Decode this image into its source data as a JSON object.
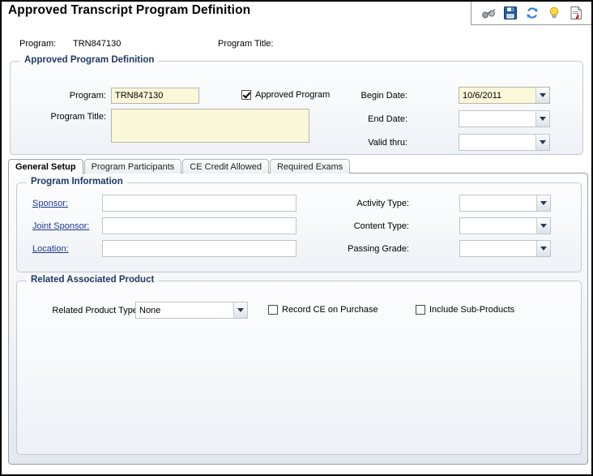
{
  "window": {
    "title": "Approved Transcript Program Definition"
  },
  "toolbar": {
    "items": [
      {
        "name": "binoculars-icon",
        "tooltip": "Find"
      },
      {
        "name": "save-icon",
        "tooltip": "Save"
      },
      {
        "name": "refresh-icon",
        "tooltip": "Refresh"
      },
      {
        "name": "lightbulb-icon",
        "tooltip": "Hint"
      },
      {
        "name": "report-icon",
        "tooltip": "Report"
      }
    ]
  },
  "summary": {
    "program_label": "Program:",
    "program_value": "TRN847130",
    "program_title_label": "Program Title:",
    "program_title_value": ""
  },
  "approved_program_definition": {
    "legend": "Approved Program Definition",
    "program_label": "Program:",
    "program_value": "TRN847130",
    "approved_checkbox_label": "Approved Program",
    "approved_checked": true,
    "program_title_label": "Program Title:",
    "program_title_value": "",
    "begin_date_label": "Begin Date:",
    "begin_date_value": "10/6/2011",
    "end_date_label": "End Date:",
    "end_date_value": "",
    "valid_thru_label": "Valid thru:",
    "valid_thru_value": ""
  },
  "tabs": [
    {
      "label": "General Setup",
      "active": true
    },
    {
      "label": "Program Participants",
      "active": false
    },
    {
      "label": "CE Credit Allowed",
      "active": false
    },
    {
      "label": "Required Exams",
      "active": false
    }
  ],
  "program_information": {
    "legend": "Program Information",
    "sponsor_label": "Sponsor:",
    "sponsor_value": "",
    "joint_sponsor_label": "Joint Sponsor:",
    "joint_sponsor_value": "",
    "location_label": "Location:",
    "location_value": "",
    "activity_type_label": "Activity Type:",
    "activity_type_value": "",
    "content_type_label": "Content Type:",
    "content_type_value": "",
    "passing_grade_label": "Passing Grade:",
    "passing_grade_value": ""
  },
  "related_associated_product": {
    "legend": "Related Associated Product",
    "related_product_type_label": "Related Product Type:",
    "related_product_type_value": "None",
    "record_ce_label": "Record CE on Purchase",
    "record_ce_checked": false,
    "include_sub_products_label": "Include Sub-Products",
    "include_sub_products_checked": false
  },
  "colors": {
    "required_field_bg": "#FBF7D9",
    "legend_text": "#1F3864",
    "link_text": "#1F3A93",
    "panel_border": "#9AA0A8"
  }
}
